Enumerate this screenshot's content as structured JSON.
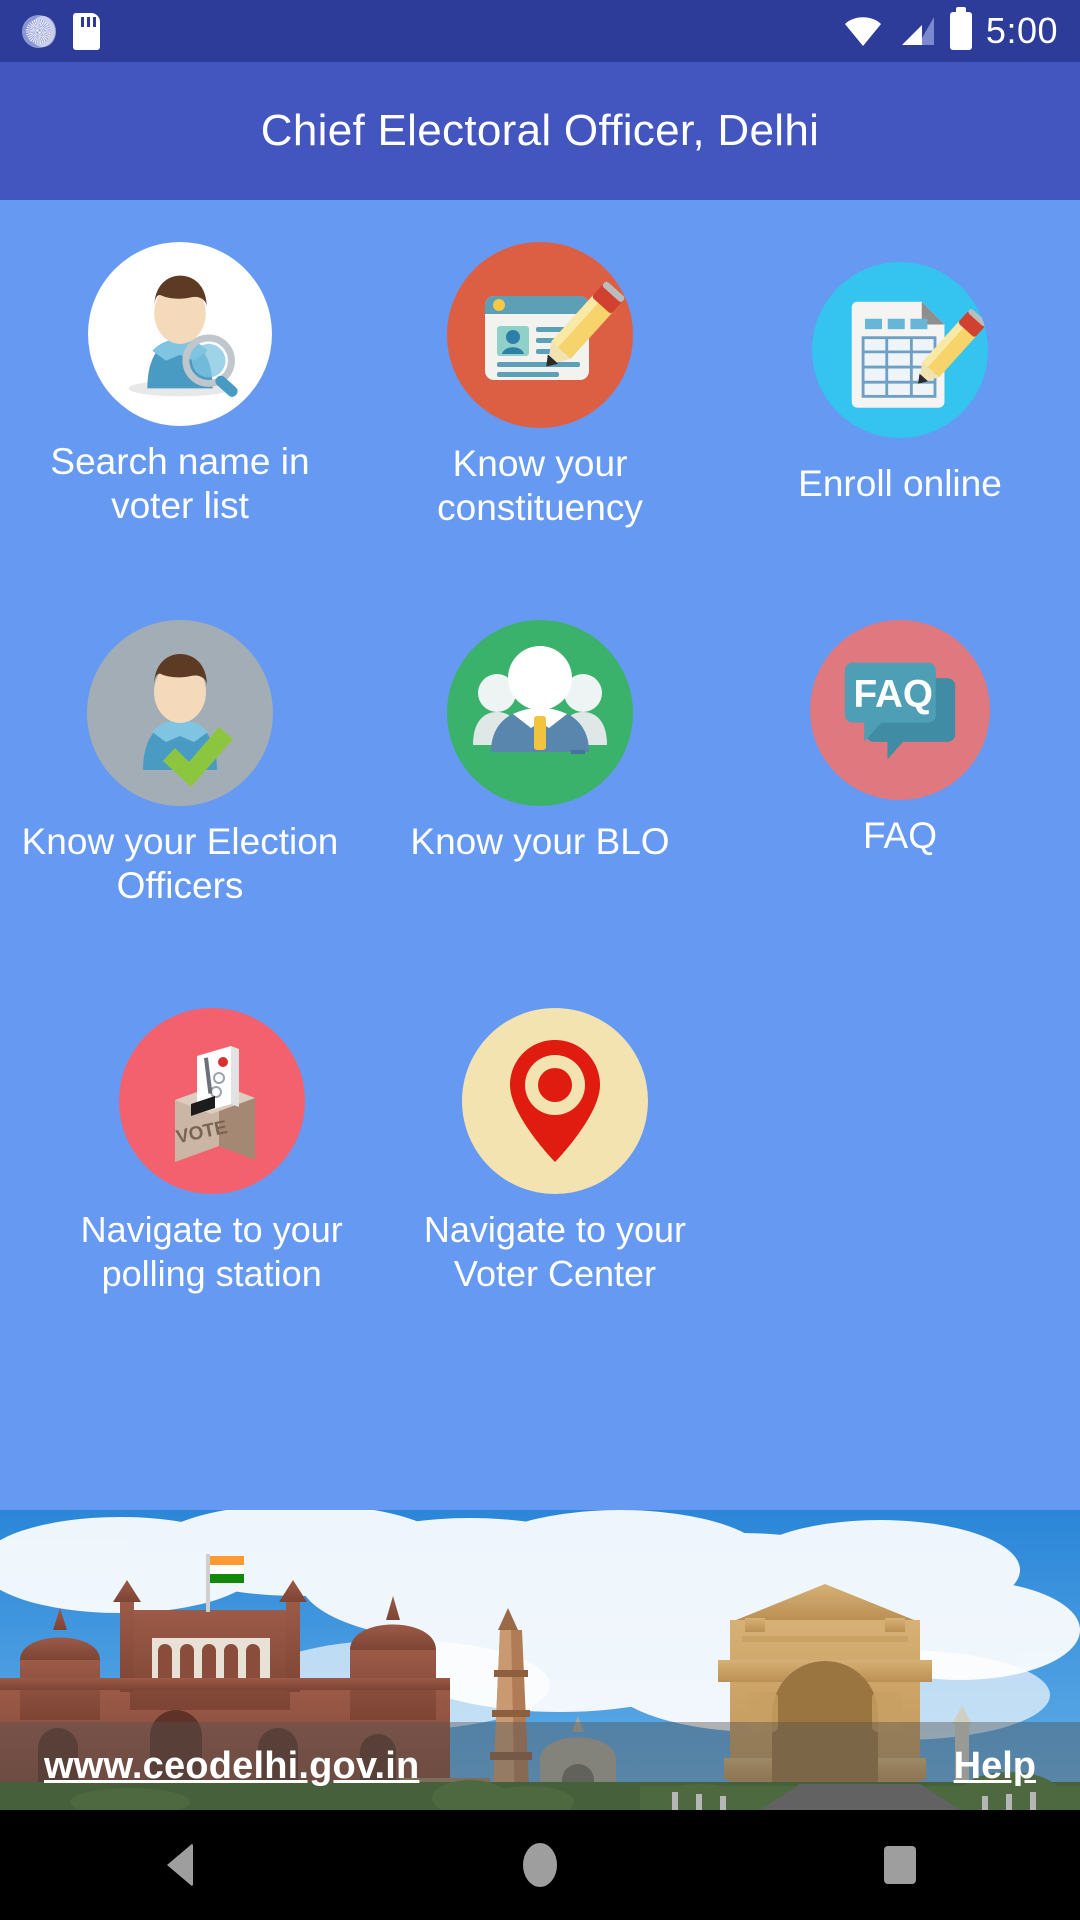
{
  "status_bar": {
    "time": "5:00",
    "left_icons": [
      "sync-icon",
      "sd-card-icon"
    ],
    "right_icons": [
      "wifi-icon",
      "cellular-signal-icon",
      "battery-icon"
    ],
    "background_color": "#2e3c99"
  },
  "app_bar": {
    "title": "Chief Electoral Officer, Delhi",
    "background_color": "#4356c0",
    "text_color": "#ffffff"
  },
  "page": {
    "background_color": "#6699f2"
  },
  "grid": {
    "rows": [
      {
        "tiles": [
          {
            "label": "Search name in voter list",
            "icon": "person-search-icon",
            "circle_color": "#ffffff"
          },
          {
            "label": "Know your constituency",
            "icon": "id-card-pencil-icon",
            "circle_color": "#dd5f43"
          },
          {
            "label": "Enroll online",
            "icon": "form-table-pencil-icon",
            "circle_color": "#35c3ef"
          }
        ]
      },
      {
        "tiles": [
          {
            "label": "Know your Election Officers",
            "icon": "person-check-icon",
            "circle_color": "#a3adb5"
          },
          {
            "label": "Know your BLO",
            "icon": "people-group-icon",
            "circle_color": "#3bb26b"
          },
          {
            "label": "FAQ",
            "icon": "faq-speech-bubble-icon",
            "circle_color": "#e0797f"
          }
        ]
      },
      {
        "tiles": [
          {
            "label": "Navigate to your polling station",
            "icon": "ballot-box-icon",
            "circle_color": "#f4616e"
          },
          {
            "label": "Navigate to your Voter Center",
            "icon": "map-pin-icon",
            "circle_color": "#f2e3b1"
          }
        ]
      }
    ]
  },
  "banner": {
    "alt": "delhi-monuments-banner",
    "monuments": [
      "Red Fort",
      "Qutub Minar",
      "India Gate"
    ],
    "sky_color": "#2e8bd8"
  },
  "footer": {
    "site_link": "www.ceodelhi.gov.in",
    "help_label": "Help"
  },
  "nav_bar": {
    "back": "back-icon",
    "home": "home-icon",
    "recents": "recents-icon"
  }
}
